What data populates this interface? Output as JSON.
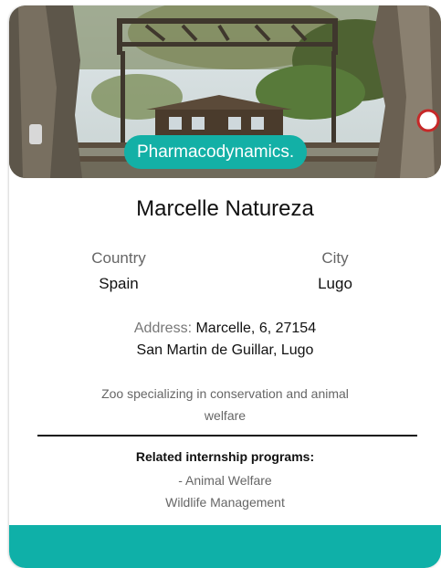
{
  "card": {
    "category_badge": "Pharmacodynamics.",
    "title": "Marcelle Natureza",
    "country": {
      "label": "Country",
      "value": "Spain"
    },
    "city": {
      "label": "City",
      "value": "Lugo"
    },
    "address": {
      "label": "Address:",
      "line1": "Marcelle, 6, 27154",
      "line2": "San Martin de Guillar, Lugo"
    },
    "description": "Zoo specializing in conservation and animal welfare",
    "programs": {
      "heading": "Related internship programs:",
      "items": [
        "- Animal Welfare",
        "Wildlife Management"
      ]
    }
  },
  "colors": {
    "accent": "#13b0a6",
    "footer": "#0fb0a8"
  }
}
